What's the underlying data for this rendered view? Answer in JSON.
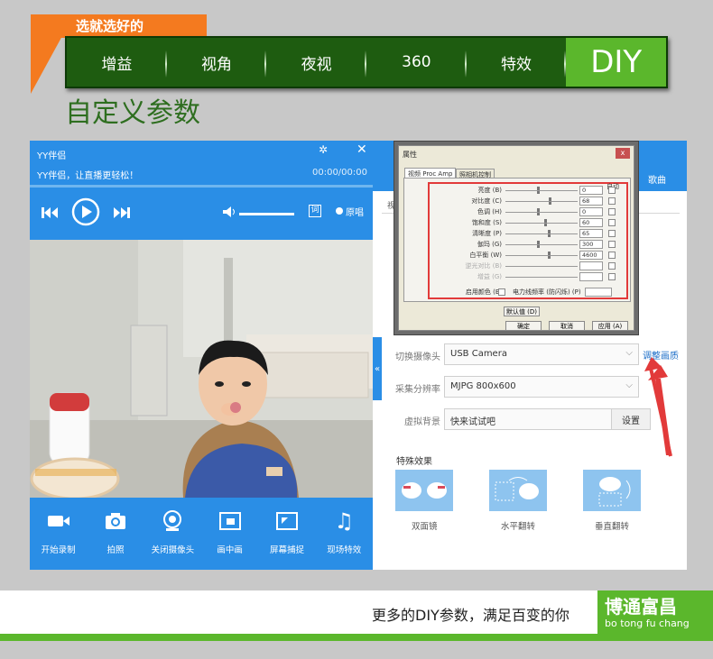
{
  "banner": {
    "tag": "选就选好的",
    "nav": [
      "增益",
      "视角",
      "夜视",
      "360",
      "特效",
      "DIY"
    ],
    "active_index": 5,
    "subtitle": "自定义参数"
  },
  "player": {
    "app_title": "YY伴侣",
    "slogan": "YY伴侣，让直播更轻松！",
    "time": "00:00/00:00",
    "lyrics_label": "词",
    "original_label": "原唱",
    "volume_fraction": 0.95,
    "toolbar": [
      {
        "label": "开始录制",
        "icon": "video-camera-icon"
      },
      {
        "label": "拍照",
        "icon": "camera-icon"
      },
      {
        "label": "关闭摄像头",
        "icon": "webcam-icon"
      },
      {
        "label": "画中画",
        "icon": "picture-in-picture-icon"
      },
      {
        "label": "屏幕捕捉",
        "icon": "screen-capture-icon"
      },
      {
        "label": "现场特效",
        "icon": "music-note-icon"
      }
    ]
  },
  "settings": {
    "song_label": "歌曲",
    "tab_fragment": "视",
    "switch_camera_label": "切换摄像头",
    "camera_value": "USB Camera",
    "adjust_link": "调整画质",
    "resolution_label": "采集分辨率",
    "resolution_value": "MJPG 800x600",
    "virtual_bg_label": "虚拟背景",
    "virtual_bg_value": "快来试试吧",
    "set_button": "设置",
    "effects_title": "特殊效果",
    "effects": [
      "双面镜",
      "水平翻转",
      "垂直翻转"
    ]
  },
  "dialog": {
    "title": "属性",
    "close": "x",
    "tabs": [
      "视频 Proc Amp",
      "照相机控制"
    ],
    "auto_label": "自动",
    "rows": [
      {
        "label": "亮度 (B)",
        "value": "0",
        "pos": 0.45
      },
      {
        "label": "对比度 (C)",
        "value": "68",
        "pos": 0.62
      },
      {
        "label": "色调 (H)",
        "value": "0",
        "pos": 0.45
      },
      {
        "label": "饱和度 (S)",
        "value": "60",
        "pos": 0.55
      },
      {
        "label": "清晰度 (P)",
        "value": "65",
        "pos": 0.6
      },
      {
        "label": "伽玛 (G)",
        "value": "300",
        "pos": 0.45
      },
      {
        "label": "白平衡 (W)",
        "value": "4600",
        "pos": 0.6
      },
      {
        "label": "逆光对比 (B)",
        "value": "",
        "pos": 0.0
      },
      {
        "label": "增益 (G)",
        "value": "",
        "pos": 0.0
      }
    ],
    "color_enable": "启用颜色 (E)",
    "powerline": "电力线频率 (防闪烁) (P)",
    "default_btn": "默认值 (D)",
    "ok": "确定",
    "cancel": "取消",
    "apply": "应用 (A)"
  },
  "footer": {
    "text": "更多的DIY参数，满足百变的你",
    "logo": "博通富昌",
    "logo_sub": "bo tong fu chang"
  },
  "colors": {
    "brand_green": "#5bb72c",
    "dark_green": "#1e5c10",
    "orange": "#f47a1f",
    "yy_blue": "#2a8ee6",
    "alert_red": "#e23a3a"
  }
}
